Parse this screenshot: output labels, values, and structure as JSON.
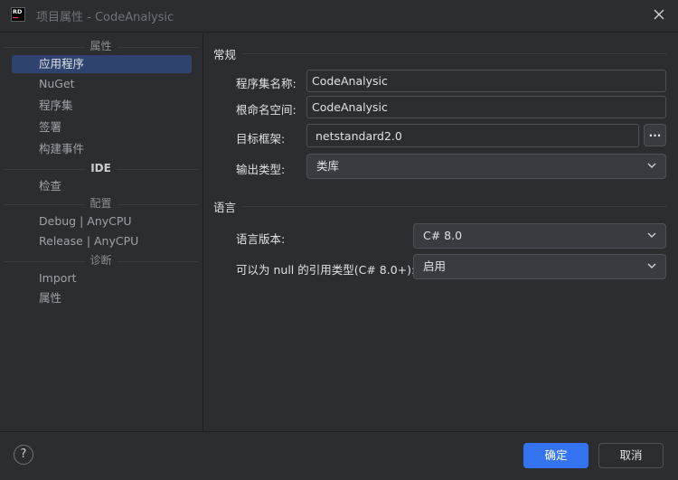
{
  "window": {
    "logo_text": "RD",
    "title": "项目属性 - CodeAnalysic"
  },
  "sidebar": {
    "groups": [
      {
        "header": "属性",
        "items": [
          {
            "label": "应用程序",
            "selected": true
          },
          {
            "label": "NuGet"
          },
          {
            "label": "程序集"
          },
          {
            "label": "签署"
          },
          {
            "label": "构建事件"
          }
        ]
      },
      {
        "header": "IDE",
        "items": [
          {
            "label": "检查"
          }
        ]
      },
      {
        "header": "配置",
        "items": [
          {
            "label": "Debug | AnyCPU"
          },
          {
            "label": "Release | AnyCPU"
          }
        ]
      },
      {
        "header": "诊断",
        "items": [
          {
            "label": "Import"
          },
          {
            "label": "属性"
          }
        ]
      }
    ]
  },
  "general": {
    "section_title": "常规",
    "assembly_name": {
      "label": "程序集名称:",
      "value": "CodeAnalysic"
    },
    "root_namespace": {
      "label": "根命名空间:",
      "value": "CodeAnalysic"
    },
    "target_framework": {
      "label": "目标框架:",
      "value": "netstandard2.0",
      "browse_label": "..."
    },
    "output_type": {
      "label": "输出类型:",
      "value": "类库"
    }
  },
  "language": {
    "section_title": "语言",
    "language_version": {
      "label": "语言版本:",
      "value": "C# 8.0"
    },
    "nullable": {
      "label": "可以为 null 的引用类型(C# 8.0+):",
      "value": "启用"
    }
  },
  "footer": {
    "help_label": "?",
    "ok_label": "确定",
    "cancel_label": "取消"
  },
  "colors": {
    "background": "#2b2d30",
    "accent": "#3574f0",
    "selection": "#2e436e"
  }
}
